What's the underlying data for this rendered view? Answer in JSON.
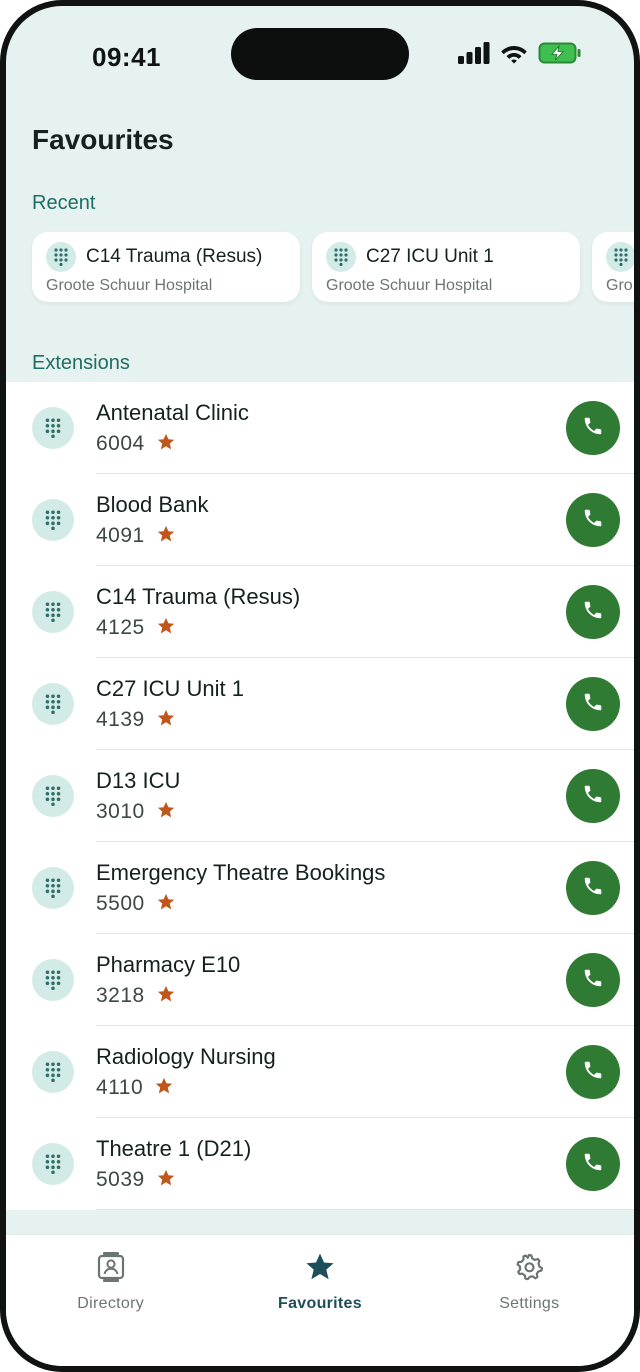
{
  "status": {
    "time": "09:41"
  },
  "header": {
    "title": "Favourites"
  },
  "recent": {
    "label": "Recent",
    "items": [
      {
        "name": "C14 Trauma (Resus)",
        "hospital": "Groote Schuur Hospital"
      },
      {
        "name": "C27 ICU Unit 1",
        "hospital": "Groote Schuur Hospital"
      },
      {
        "name": "",
        "hospital": "Gro"
      }
    ]
  },
  "extensions": {
    "label": "Extensions",
    "items": [
      {
        "name": "Antenatal Clinic",
        "ext": "6004"
      },
      {
        "name": "Blood Bank",
        "ext": "4091"
      },
      {
        "name": "C14 Trauma (Resus)",
        "ext": "4125"
      },
      {
        "name": "C27 ICU Unit 1",
        "ext": "4139"
      },
      {
        "name": "D13 ICU",
        "ext": "3010"
      },
      {
        "name": "Emergency Theatre Bookings",
        "ext": "5500"
      },
      {
        "name": "Pharmacy E10",
        "ext": "3218"
      },
      {
        "name": "Radiology Nursing",
        "ext": "4110"
      },
      {
        "name": "Theatre 1 (D21)",
        "ext": "5039"
      }
    ]
  },
  "tabs": [
    {
      "label": "Directory",
      "icon": "contact-card-icon",
      "active": false
    },
    {
      "label": "Favourites",
      "icon": "star-icon",
      "active": true
    },
    {
      "label": "Settings",
      "icon": "gear-icon",
      "active": false
    }
  ],
  "colors": {
    "background": "#e6f2ef",
    "accent": "#1f6e65",
    "call": "#2f7b34",
    "star": "#c0561b",
    "active_tab": "#1e4e5c"
  }
}
